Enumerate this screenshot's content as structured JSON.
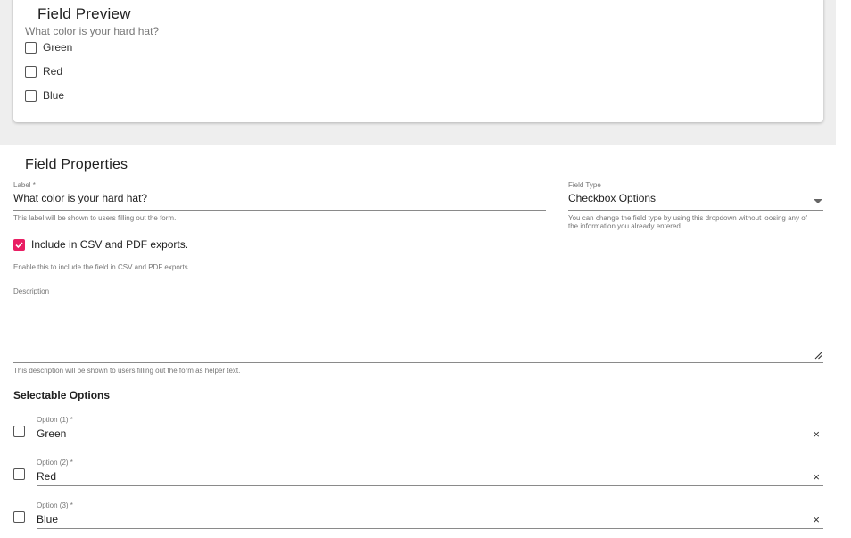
{
  "preview": {
    "title": "Field Preview",
    "question": "What color is your hard hat?",
    "options": [
      "Green",
      "Red",
      "Blue"
    ]
  },
  "properties": {
    "title": "Field Properties",
    "label_field": {
      "label": "Label *",
      "value": "What color is your hard hat?",
      "helper": "This label will be shown to users filling out the form."
    },
    "field_type": {
      "label": "Field Type",
      "value": "Checkbox Options",
      "helper": "You can change the field type by using this dropdown without loosing any of the information you already entered."
    },
    "export_checkbox": {
      "label": "Include in CSV and PDF exports.",
      "checked": true,
      "helper": "Enable this to include the field in CSV and PDF exports."
    },
    "description_field": {
      "label": "Description",
      "value": "",
      "helper": "This description will be shown to users filling out the form as helper text."
    },
    "selectable_options": {
      "title": "Selectable Options",
      "items": [
        {
          "label": "Option (1) *",
          "value": "Green"
        },
        {
          "label": "Option (2) *",
          "value": "Red"
        },
        {
          "label": "Option (3) *",
          "value": "Blue"
        }
      ]
    }
  },
  "colors": {
    "accent": "#e91e63",
    "page_bg": "#eeeeee"
  }
}
